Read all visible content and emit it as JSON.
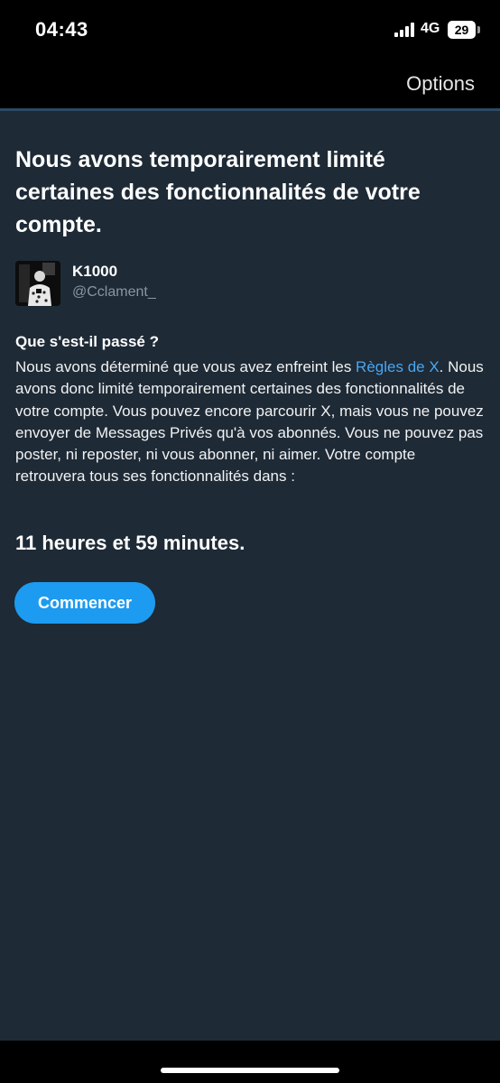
{
  "status_bar": {
    "time": "04:43",
    "network": "4G",
    "battery_level": "29",
    "signal_icon": "cellular-signal-icon",
    "battery_icon": "battery-icon"
  },
  "header": {
    "options_label": "Options"
  },
  "main": {
    "title": "Nous avons temporairement limité certaines des fonctionnalités de votre compte.",
    "user": {
      "name": "K1000",
      "handle": "@Cclament_"
    },
    "section_heading": "Que s'est-il passé ?",
    "body_before_link": "Nous avons déterminé que vous avez enfreint les ",
    "rules_link": "Règles de X",
    "body_after_link": ". Nous avons donc limité temporairement certaines des fonctionnalités de votre compte. Vous pouvez encore parcourir X, mais vous ne pouvez envoyer de Messages Privés qu'à vos abonnés. Vous ne pouvez pas poster, ni reposter, ni vous abonner, ni aimer. Votre compte retrouvera tous ses fonctionnalités dans :",
    "countdown": "11 heures et 59 minutes.",
    "start_button_label": "Commencer"
  },
  "colors": {
    "background": "#1e2a36",
    "accent": "#1d9bf0",
    "link": "#4aa6f0",
    "muted_text": "#8a96a3"
  }
}
